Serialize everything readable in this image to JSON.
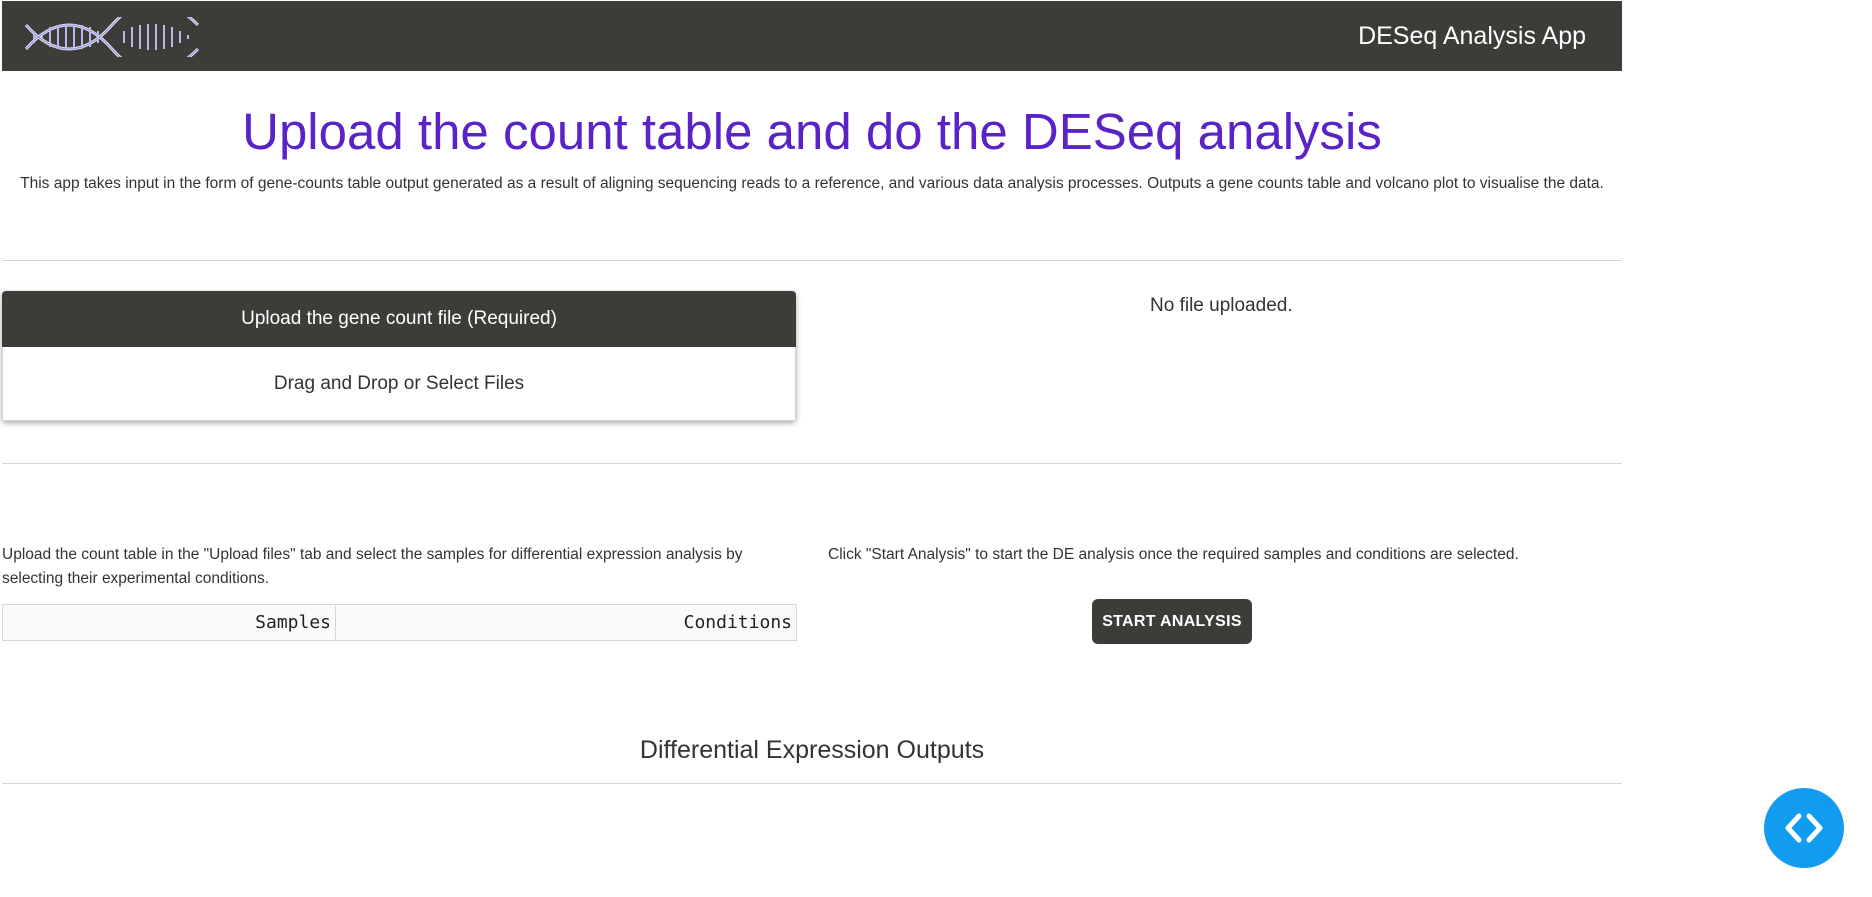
{
  "header": {
    "app_title": "DESeq Analysis App",
    "logo_icon": "dna-helix-logo"
  },
  "main": {
    "title": "Upload the count table and do the DESeq analysis",
    "description": "This app takes input in the form of gene-counts table output generated as a result of aligning sequencing reads to a reference, and various data analysis processes. Outputs a gene counts table and volcano plot to visualise the data."
  },
  "upload": {
    "header": "Upload the gene count file (Required)",
    "dropzone_label": "Drag and Drop or Select Files",
    "status": "No file uploaded."
  },
  "analysis": {
    "left_instructions": "Upload the count table in the \"Upload files\" tab and select the samples for differential expression analysis by selecting their experimental conditions.",
    "right_instructions": "Click \"Start Analysis\" to start the DE analysis once the required samples and conditions are selected.",
    "table_headers": [
      "Samples",
      "Conditions"
    ],
    "start_button": "START ANALYSIS"
  },
  "outputs": {
    "title": "Differential Expression Outputs"
  },
  "debug_fab": {
    "icon": "code-brackets-icon"
  },
  "colors": {
    "navbar": "#3d3c39",
    "title": "#5a23c8",
    "fab": "#129cf0"
  }
}
